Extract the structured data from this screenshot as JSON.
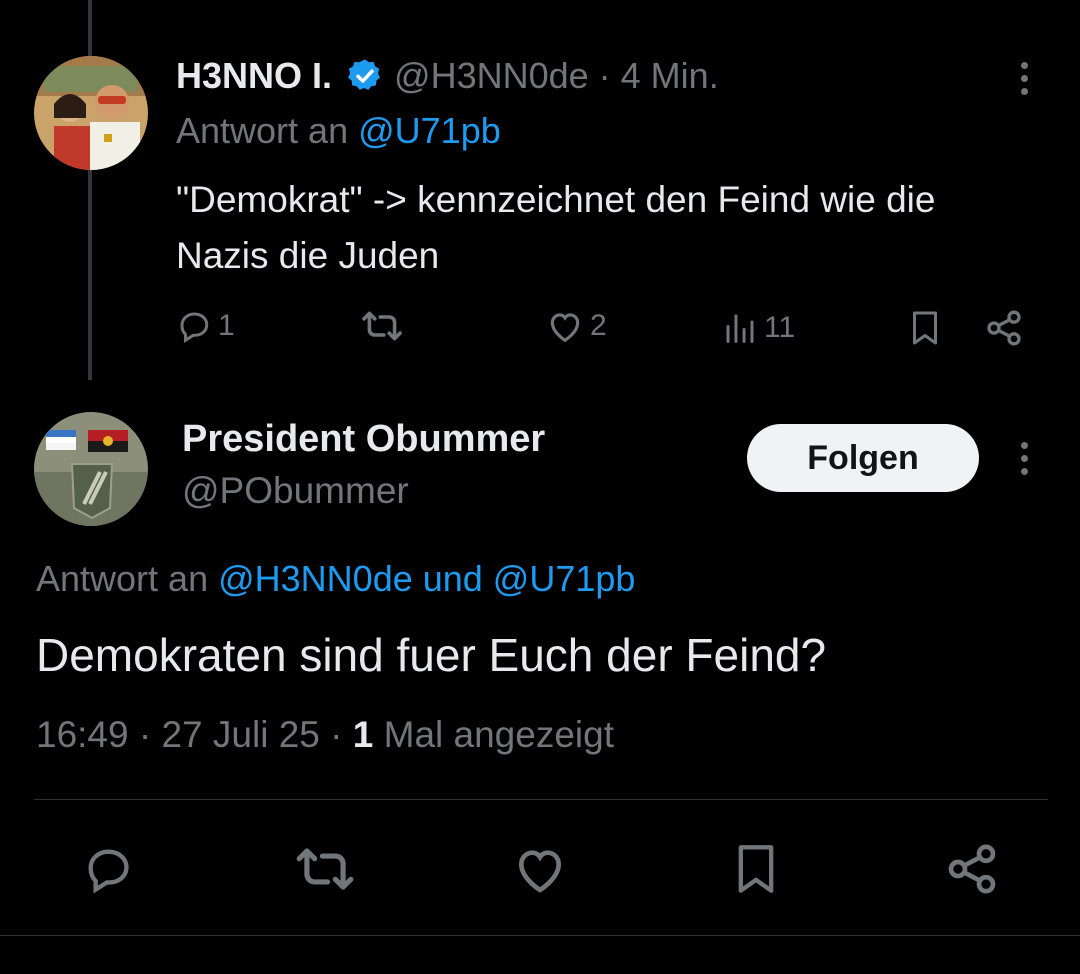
{
  "first_tweet": {
    "display_name": "H3NNO I.",
    "handle": "@H3NN0de",
    "separator": "·",
    "time": "4 Min.",
    "reply_prefix": "Antwort an",
    "reply_handle": "@U71pb",
    "text": "\"Demokrat\" -> kennzeichnet den Feind wie die Nazis die Juden",
    "reply_count": "1",
    "like_count": "2",
    "view_count": "11",
    "avatar_icon": "user-avatar-illustration"
  },
  "second_tweet": {
    "display_name": "President Obummer",
    "handle": "@PObummer",
    "follow_label": "Folgen",
    "reply_prefix": "Antwort an",
    "reply_handles": "@H3NN0de und @U71pb",
    "text": "Demokraten sind fuer Euch der Feind?",
    "time": "16:49",
    "date": "27 Juli 25",
    "separator": "·",
    "view_count": "1",
    "view_label": "Mal angezeigt",
    "avatar_icon": "patch-avatar-photo"
  },
  "colors": {
    "background": "#000000",
    "text": "#e7e9ea",
    "muted": "#71767b",
    "accent": "#1d9bf0",
    "button_bg": "#eff3f4"
  }
}
